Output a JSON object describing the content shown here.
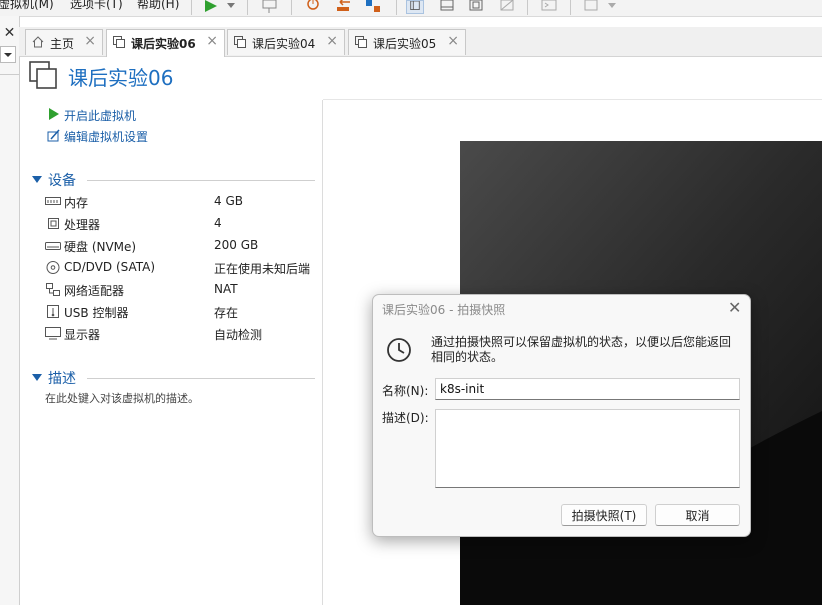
{
  "menubar": {
    "items": [
      "虚拟机(M)",
      "选项卡(T)",
      "帮助(H)"
    ]
  },
  "tabs": [
    {
      "label": "主页",
      "icon": "home-icon"
    },
    {
      "label": "课后实验06",
      "icon": "vm-icon",
      "active": true
    },
    {
      "label": "课后实验04",
      "icon": "vm-icon"
    },
    {
      "label": "课后实验05",
      "icon": "vm-icon"
    }
  ],
  "vm": {
    "title": "课后实验06",
    "actions": {
      "power_on": "开启此虚拟机",
      "edit_settings": "编辑虚拟机设置"
    },
    "devices_heading": "设备",
    "devices": [
      {
        "name": "内存",
        "value": "4 GB",
        "icon": "memory-icon"
      },
      {
        "name": "处理器",
        "value": "4",
        "icon": "cpu-icon"
      },
      {
        "name": "硬盘 (NVMe)",
        "value": "200 GB",
        "icon": "disk-icon"
      },
      {
        "name": "CD/DVD (SATA)",
        "value": "正在使用未知后端",
        "icon": "cd-icon"
      },
      {
        "name": "网络适配器",
        "value": "NAT",
        "icon": "network-icon"
      },
      {
        "name": "USB 控制器",
        "value": "存在",
        "icon": "usb-icon"
      },
      {
        "name": "显示器",
        "value": "自动检测",
        "icon": "monitor-icon"
      }
    ],
    "description_heading": "描述",
    "description_placeholder": "在此处键入对该虚拟机的描述。"
  },
  "dialog": {
    "title": "课后实验06 - 拍摄快照",
    "message": "通过拍摄快照可以保留虚拟机的状态，以便以后您能返回相同的状态。",
    "name_label": "名称(N):",
    "name_value": "k8s-init",
    "desc_label": "描述(D):",
    "desc_value": "",
    "ok_button": "拍摄快照(T)",
    "cancel_button": "取消"
  },
  "colors": {
    "accent": "#1e6fc0",
    "link": "#1b5fa8",
    "play_green": "#2fa02f",
    "vm_screen": "#0a0a0a"
  }
}
